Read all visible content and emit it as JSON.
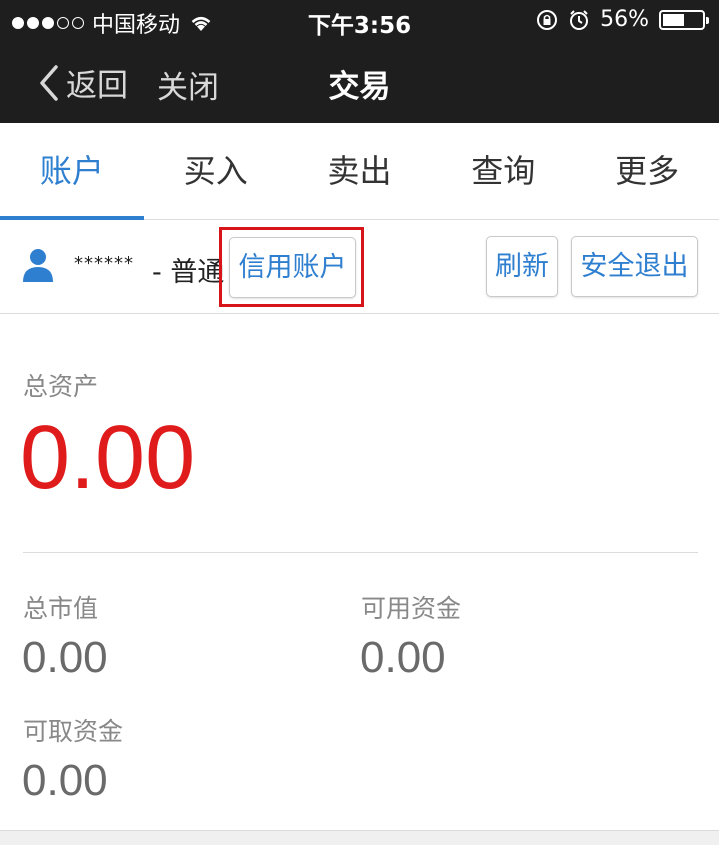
{
  "status_bar": {
    "carrier": "中国移动",
    "time": "下午3:56",
    "battery_percent_text": "56%",
    "battery_level": 0.56,
    "signal_bars_filled": 3,
    "signal_bars_total": 5
  },
  "nav": {
    "back_label": "返回",
    "close_label": "关闭",
    "title": "交易"
  },
  "tabs": [
    {
      "label": "账户",
      "active": true
    },
    {
      "label": "买入",
      "active": false
    },
    {
      "label": "卖出",
      "active": false
    },
    {
      "label": "查询",
      "active": false
    },
    {
      "label": "更多",
      "active": false
    }
  ],
  "account": {
    "masked_id": "******",
    "type_label": "- 普通",
    "credit_button": "信用账户",
    "refresh_button": "刷新",
    "logout_button": "安全退出"
  },
  "summary": {
    "total_assets_label": "总资产",
    "total_assets_value": "0.00",
    "market_value_label": "总市值",
    "market_value": "0.00",
    "available_funds_label": "可用资金",
    "available_funds": "0.00",
    "withdrawable_funds_label": "可取资金",
    "withdrawable_funds": "0.00"
  },
  "colors": {
    "accent": "#2f7fd0",
    "highlight": "#d8141b",
    "total_value": "#e01b1b",
    "header_bg": "#1e1e1e"
  }
}
